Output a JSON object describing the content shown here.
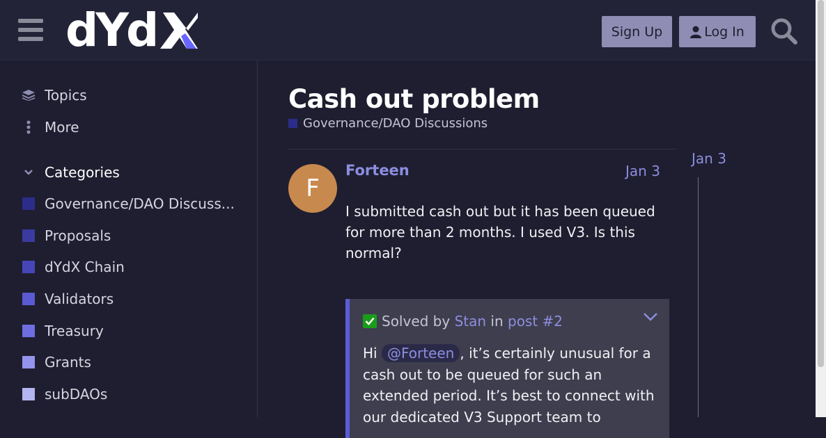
{
  "header": {
    "logo_text": "dYdX",
    "signup_label": "Sign Up",
    "login_label": "Log In"
  },
  "sidebar": {
    "topics_label": "Topics",
    "more_label": "More",
    "categories_label": "Categories",
    "categories": [
      {
        "label": "Governance/DAO Discuss...",
        "color": "#2c2c8a"
      },
      {
        "label": "Proposals",
        "color": "#3a3aa0"
      },
      {
        "label": "dYdX Chain",
        "color": "#4646b8"
      },
      {
        "label": "Validators",
        "color": "#5a5ad2"
      },
      {
        "label": "Treasury",
        "color": "#6e6ee0"
      },
      {
        "label": "Grants",
        "color": "#9494ec"
      },
      {
        "label": "subDAOs",
        "color": "#b4b4f0"
      }
    ]
  },
  "topic": {
    "title": "Cash out problem",
    "category": "Governance/DAO Discussions"
  },
  "post": {
    "avatar_letter": "F",
    "username": "Forteen",
    "date": "Jan 3",
    "body": "I submitted cash out but it has been queued for more than 2 months. I used V3. Is this normal?"
  },
  "solution": {
    "solved_by": "Solved by",
    "author": "Stan",
    "in_text": "in",
    "post_link": "post #2",
    "greeting": "Hi",
    "mention": "@Forteen",
    "text": ", it’s certainly unusual for a cash out to be queued for such an extended period. It’s best to connect with our dedicated V3 Support team to"
  },
  "timeline": {
    "date": "Jan 3"
  }
}
